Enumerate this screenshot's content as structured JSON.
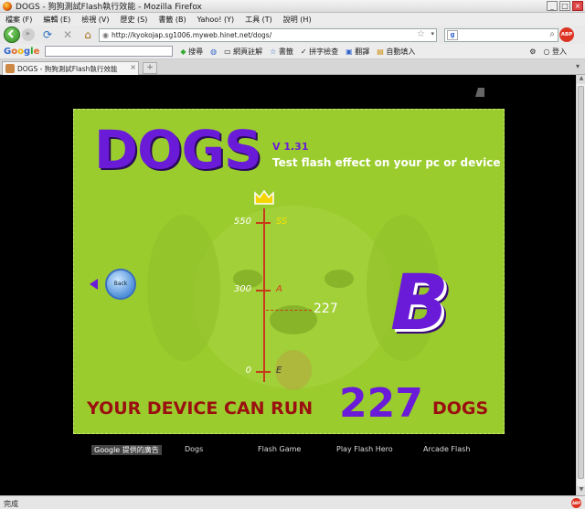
{
  "window": {
    "title": "DOGS - 狗狗測試Flash執行效能 - Mozilla Firefox",
    "minimize": "_",
    "maximize": "□",
    "close": "×"
  },
  "menu": [
    "檔案 (F)",
    "編輯 (E)",
    "檢視 (V)",
    "歷史 (S)",
    "書籤 (B)",
    "Yahoo! (Y)",
    "工具 (T)",
    "說明 (H)"
  ],
  "nav": {
    "url": "http://kyokojap.sg1006.myweb.hinet.net/dogs/",
    "search_engine": "g",
    "abp": "ABP"
  },
  "google_bar": {
    "logo": [
      "G",
      "o",
      "o",
      "g",
      "l",
      "e"
    ],
    "items": [
      "搜尋",
      "網頁註解",
      "書籤",
      "拼字檢查",
      "翻譯",
      "自動填入"
    ],
    "right": "登入"
  },
  "tab": {
    "title": "DOGS - 狗狗測試Flash執行效能",
    "close": "×",
    "new": "+"
  },
  "flash": {
    "logo": "DOGS",
    "version": "V 1.31",
    "tagline": "Test flash effect on your pc or device",
    "back_label": "Back",
    "grade": "B",
    "score": "227",
    "result_prefix": "YOUR DEVICE CAN RUN",
    "result_suffix": "DOGS",
    "scale": [
      {
        "value": "550",
        "grade": "SS",
        "grade_color": "#f6e100"
      },
      {
        "value": "300",
        "grade": "A",
        "grade_color": "#d83a1a"
      },
      {
        "value": "0",
        "grade": "E",
        "grade_color": "#333333"
      }
    ],
    "score_value": 227,
    "scale_max": 600
  },
  "footer": {
    "links": [
      "Google 提供的廣告",
      "Dogs",
      "Flash Game",
      "Play Flash Hero",
      "Arcade Flash"
    ]
  },
  "status": {
    "text": "完成",
    "abp": "ABP"
  },
  "colors": {
    "flash_bg": "#9bcc2e",
    "logo_purple": "#6a1bd8",
    "result_red": "#9a1010"
  }
}
